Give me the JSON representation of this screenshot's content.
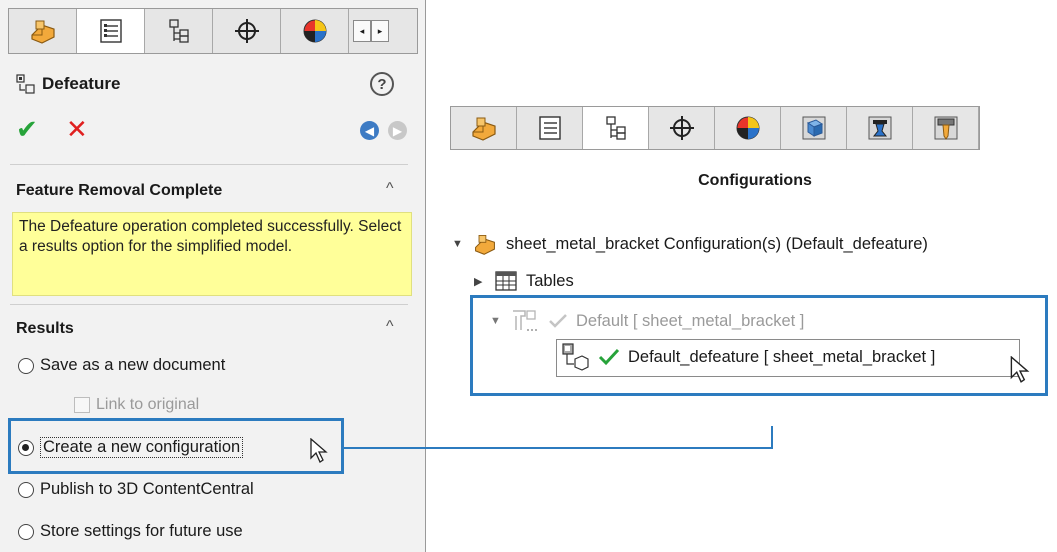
{
  "property_manager": {
    "tabs": [
      "part-icon",
      "property-manager-icon",
      "configuration-manager-icon",
      "dimxpert-icon",
      "display-manager-icon"
    ],
    "scroll_left": "◂",
    "scroll_right": "▸",
    "title": "Defeature",
    "help_glyph": "?",
    "ok_glyph": "✔",
    "cancel_glyph": "✕",
    "nav_prev_glyph": "◀",
    "nav_next_glyph": "▶",
    "feature_removal": {
      "heading": "Feature Removal Complete",
      "message": "The Defeature operation completed successfully. Select a results option for the simplified model."
    },
    "results": {
      "heading": "Results",
      "options": [
        {
          "label": "Save as a new document",
          "checked": false
        },
        {
          "label": "Create a new configuration",
          "checked": true
        },
        {
          "label": "Publish to 3D ContentCentral",
          "checked": false
        },
        {
          "label": "Store settings for future use",
          "checked": false
        }
      ],
      "link_to_original": "Link to original"
    },
    "collapse_glyph": "^"
  },
  "configuration_manager": {
    "tabs": [
      "part-icon",
      "property-manager-icon",
      "configuration-manager-icon",
      "dimxpert-icon",
      "display-manager-icon",
      "cam-icon",
      "simulation-icon",
      "toolpath-icon"
    ],
    "title": "Configurations",
    "tree": {
      "root": "sheet_metal_bracket Configuration(s)  (Default_defeature)",
      "tables": "Tables",
      "default": "Default [ sheet_metal_bracket ]",
      "defeature": "Default_defeature [ sheet_metal_bracket ]"
    },
    "expanded_glyph": "▼",
    "collapsed_glyph": "▶"
  },
  "colors": {
    "highlight": "#2c7bbf",
    "message_bg": "#ffff99",
    "ok": "#27a33a",
    "cancel": "#e02020"
  }
}
